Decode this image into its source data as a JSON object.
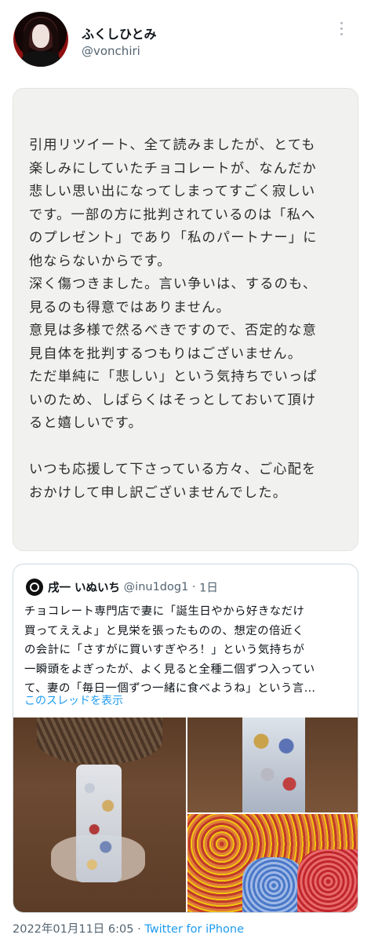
{
  "author": {
    "display_name": "ふくしひとみ",
    "handle": "@vonchiri"
  },
  "note_lines": [
    "引用リツイート、全て読みましたが、とても",
    "楽しみにしていたチョコレートが、なんだか",
    "悲しい思い出になってしまってすごく寂しい",
    "です。一部の方に批判されているのは「私へ",
    "のプレゼント」であり「私のパートナー」に",
    "他ならないからです。",
    "深く傷つきました。言い争いは、するのも、",
    "見るのも得意ではありません。",
    "意見は多様で然るべきですので、否定的な意",
    "見自体を批判するつもりはございません。",
    "ただ単純に「悲しい」という気持ちでいっぱ",
    "いのため、しばらくはそっとしておいて頂け",
    "ると嬉しいです。",
    "",
    "いつも応援して下さっている方々、ご心配を",
    "おかけして申し訳ございませんでした。"
  ],
  "quoted": {
    "name": "戌一 いぬいち",
    "handle": "@inu1dog1",
    "separator": "·",
    "time": "1日",
    "text_lines": [
      "チョコレート専門店で妻に「誕生日やから好きなだけ",
      "買ってええよ」と見栄を張ったものの、想定の倍近く",
      "の会計に「さすがに買いすぎやろ！」という気持ちが",
      "一瞬頭をよぎったが、よく見ると全種二個ずつ入ってい",
      "て、妻の「毎日一個ずつ一緒に食べようね」という言…"
    ],
    "show_thread": "このスレッドを表示"
  },
  "footer": {
    "datetime": "2022年01月11日 6:05",
    "separator": "·",
    "client": "Twitter for iPhone"
  }
}
